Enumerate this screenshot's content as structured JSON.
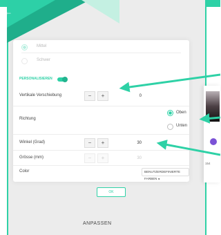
{
  "header": {
    "back_icon": "arrow-left-icon"
  },
  "dialog": {
    "options": [
      {
        "label": "Mittel",
        "selected": true
      },
      {
        "label": "Schwer",
        "selected": false
      }
    ],
    "personalize_label": "PERSONALISIEREN",
    "rows": [
      {
        "label": "Vertikale Verschiebung",
        "minus": "−",
        "plus": "+",
        "value": "0"
      },
      {
        "label": "Richtung",
        "choices": [
          "Oben",
          "Unten"
        ],
        "selected": "Oben"
      },
      {
        "label": "Winkel (Grad)",
        "minus": "−",
        "plus": "+",
        "value": "30"
      },
      {
        "label": "Grösse (mm)",
        "minus": "−",
        "plus": "+",
        "value": "30"
      },
      {
        "label": "Color",
        "chip": "BENUTZERDEFINIERTE FARBEN"
      }
    ],
    "ok_label": "OK"
  },
  "footer": {
    "label": "ANPASSEN"
  },
  "right_panel": {
    "value": "154"
  },
  "colors": {
    "accent": "#2ed1a6",
    "arrow": "#2ed1a6",
    "purple": "#7b52d6"
  }
}
